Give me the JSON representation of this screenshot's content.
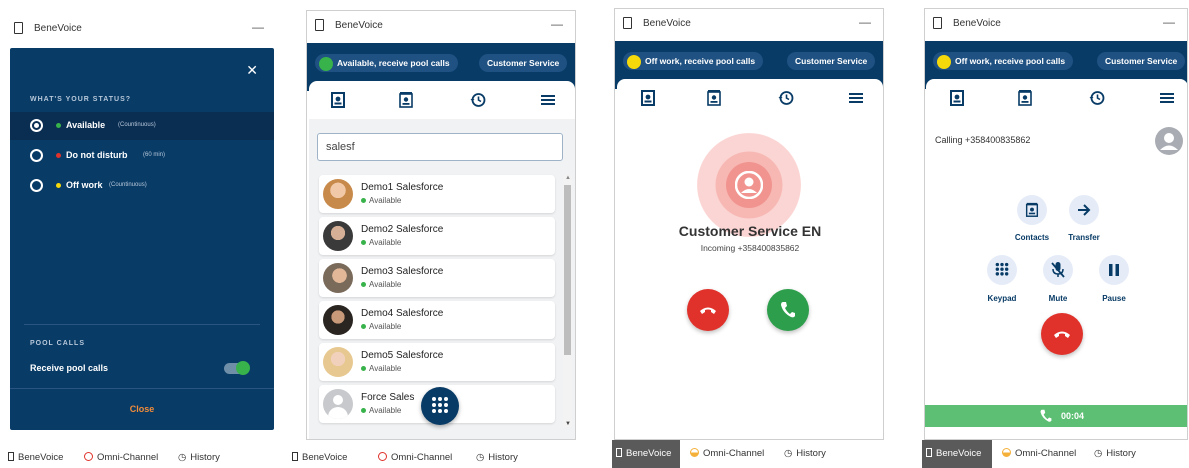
{
  "app_name": "BeneVoice",
  "title_min": "—",
  "bottom_tabs": {
    "benevoice": "BeneVoice",
    "omni": "Omni-Channel",
    "history": "History"
  },
  "panel1": {
    "close_symbol": "✕",
    "status_heading": "WHAT'S YOUR STATUS?",
    "statuses": [
      {
        "label": "Available",
        "sub": "(Countinuous)",
        "color": "#38b24a",
        "selected": true
      },
      {
        "label": "Do not disturb",
        "sub": "(60 min)",
        "color": "#e0322b",
        "selected": false
      },
      {
        "label": "Off work",
        "sub": "(Countinuous)",
        "color": "#f5d90a",
        "selected": false
      }
    ],
    "pool_heading": "POOL CALLS",
    "pool_label": "Receive pool calls",
    "pool_enabled": true,
    "close_button": "Close"
  },
  "panel2": {
    "status_pill": "Available, receive pool calls",
    "status_color": "#38b24a",
    "queue_pill": "Customer Service",
    "search_value": "salesf",
    "contacts": [
      {
        "name": "Demo1 Salesforce",
        "status": "Available"
      },
      {
        "name": "Demo2 Salesforce",
        "status": "Available"
      },
      {
        "name": "Demo3 Salesforce",
        "status": "Available"
      },
      {
        "name": "Demo4 Salesforce",
        "status": "Available"
      },
      {
        "name": "Demo5 Salesforce",
        "status": "Available"
      },
      {
        "name": "Force Sales",
        "status": "Available"
      }
    ]
  },
  "panel3": {
    "status_pill": "Off work, receive pool calls",
    "status_color": "#f5d90a",
    "queue_pill": "Customer Service",
    "caller_name": "Customer Service EN",
    "caller_info": "Incoming +358400835862"
  },
  "panel4": {
    "status_pill": "Off work, receive pool calls",
    "status_color": "#f5d90a",
    "queue_pill": "Customer Service",
    "calling_text": "Calling +358400835862",
    "controls": {
      "contacts": "Contacts",
      "transfer": "Transfer",
      "keypad": "Keypad",
      "mute": "Mute",
      "pause": "Pause"
    },
    "timer": "00:04"
  },
  "colors": {
    "navy": "#083b66",
    "green": "#38b24a",
    "red": "#e0322b",
    "orange": "#f18c3a",
    "callgreen": "#5cbf73"
  }
}
